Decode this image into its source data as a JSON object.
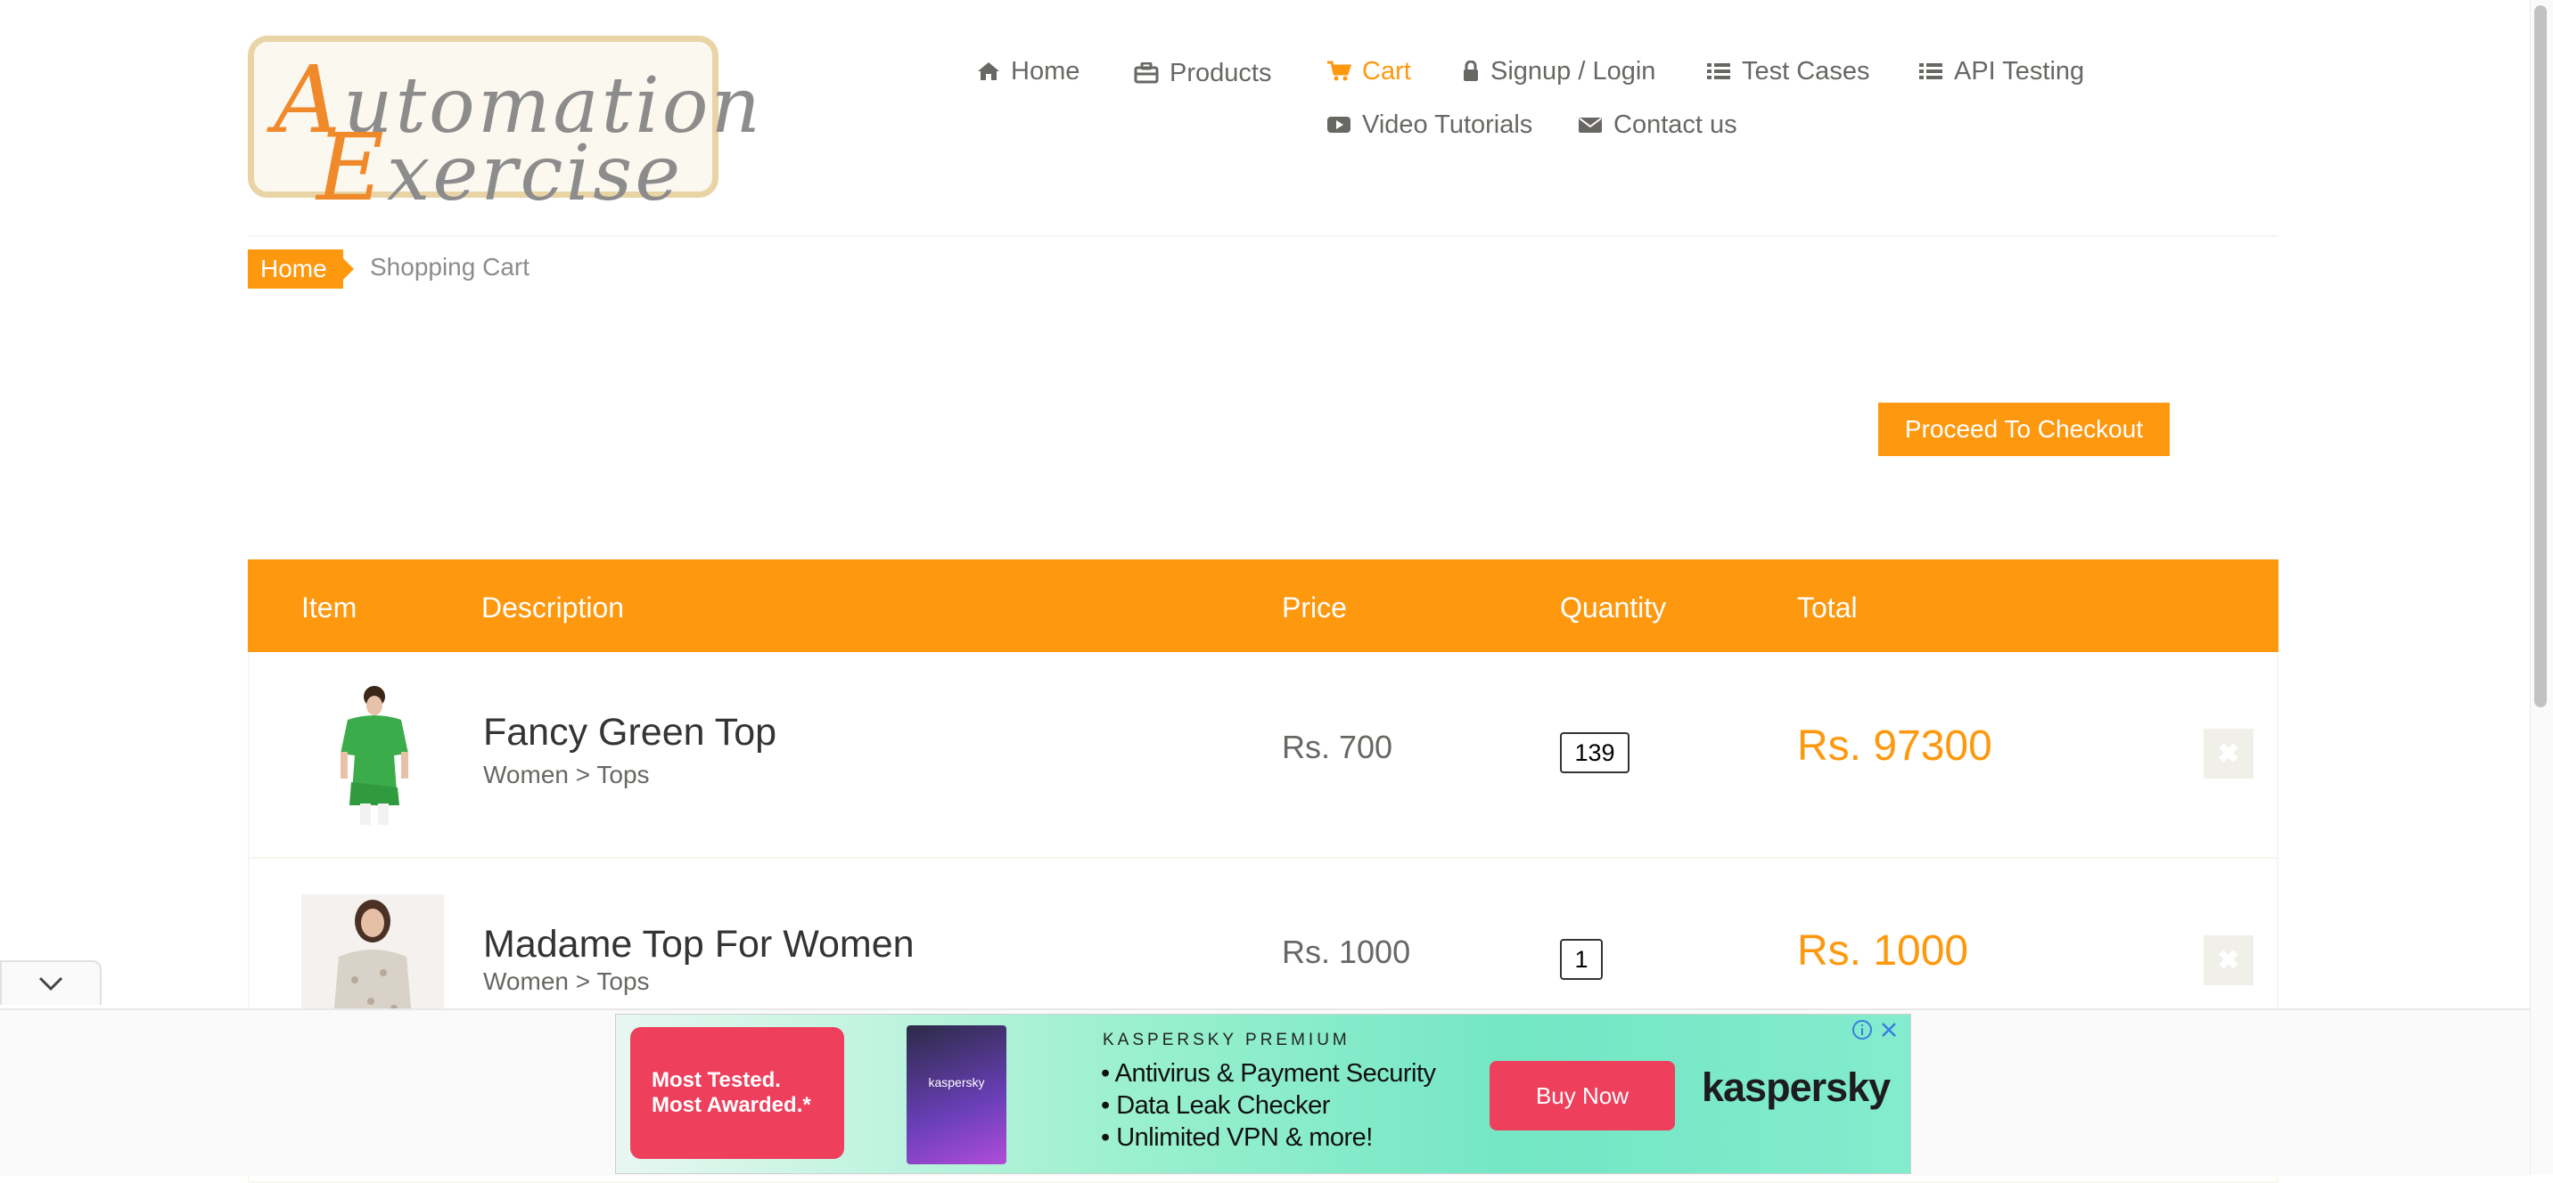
{
  "logo": {
    "line1_cap": "A",
    "line1_rest": "utomation",
    "line2_cap": "E",
    "line2_rest": "xercise"
  },
  "nav": {
    "home": "Home",
    "products": "Products",
    "cart": "Cart",
    "login": "Signup / Login",
    "test_cases": "Test Cases",
    "api_testing": "API Testing",
    "video_tutorials": "Video Tutorials",
    "contact_us": "Contact us"
  },
  "breadcrumb": {
    "home": "Home",
    "current": "Shopping Cart"
  },
  "checkout_label": "Proceed To Checkout",
  "table": {
    "headers": {
      "item": "Item",
      "description": "Description",
      "price": "Price",
      "quantity": "Quantity",
      "total": "Total"
    },
    "rows": [
      {
        "name": "Fancy Green Top",
        "category": "Women > Tops",
        "price": "Rs. 700",
        "quantity": "139",
        "total": "Rs. 97300"
      },
      {
        "name": "Madame Top For Women",
        "category": "Women > Tops",
        "price": "Rs. 1000",
        "quantity": "1",
        "total": "Rs. 1000"
      }
    ]
  },
  "ad": {
    "tagline_1": "Most Tested.",
    "tagline_2": "Most Awarded.*",
    "box_brand": "kaspersky",
    "premium": "KASPERSKY PREMIUM",
    "bullets": [
      "• Antivirus & Payment Security",
      "• Data Leak Checker",
      "• Unlimited VPN & more!"
    ],
    "buy": "Buy Now",
    "brand": "kaspersky"
  },
  "colors": {
    "accent": "#fe980f",
    "text": "#696763",
    "ad_red": "#ee3f5c"
  },
  "icons": [
    "home-icon",
    "briefcase-icon",
    "cart-icon",
    "lock-icon",
    "list-icon",
    "youtube-icon",
    "envelope-icon",
    "close-icon",
    "chevron-down-icon",
    "info-icon"
  ]
}
